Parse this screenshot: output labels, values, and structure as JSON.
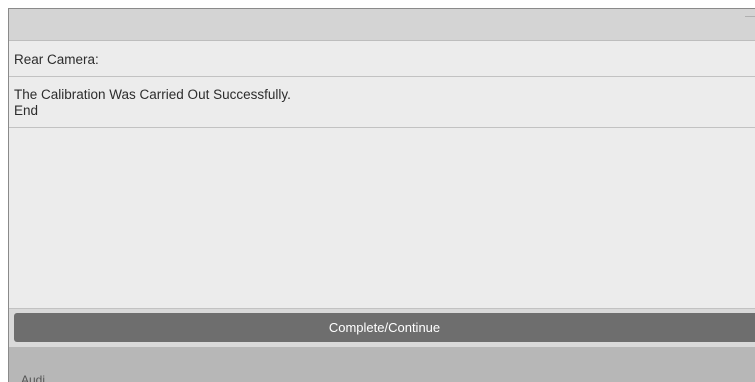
{
  "title_row": {
    "label": "Rear Camera:"
  },
  "message": {
    "line1": "The Calibration Was Carried Out Successfully.",
    "line2": "End"
  },
  "actions": {
    "continue_label": "Complete/Continue"
  },
  "footer": {
    "brand": "Audi"
  },
  "colors": {
    "background": "#ececec",
    "top_bar": "#d4d4d4",
    "button": "#6e6e6e",
    "button_text": "#ffffff",
    "footer": "#b7b7b7"
  }
}
